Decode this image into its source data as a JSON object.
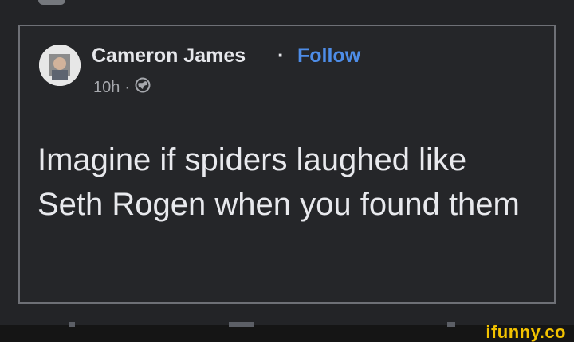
{
  "post": {
    "author": "Cameron James",
    "separator": "·",
    "follow_label": "Follow",
    "time": "10h",
    "meta_separator": "·",
    "visibility_icon": "globe-icon",
    "text": "Imagine if spiders laughed like Seth Rogen when you found them"
  },
  "watermark": {
    "text": "ifunny.co"
  },
  "colors": {
    "background": "#232427",
    "card_border": "#6e7076",
    "text": "#e8e9ed",
    "muted": "#a6a8ad",
    "follow": "#4e8de8",
    "watermark": "#f2c200"
  }
}
